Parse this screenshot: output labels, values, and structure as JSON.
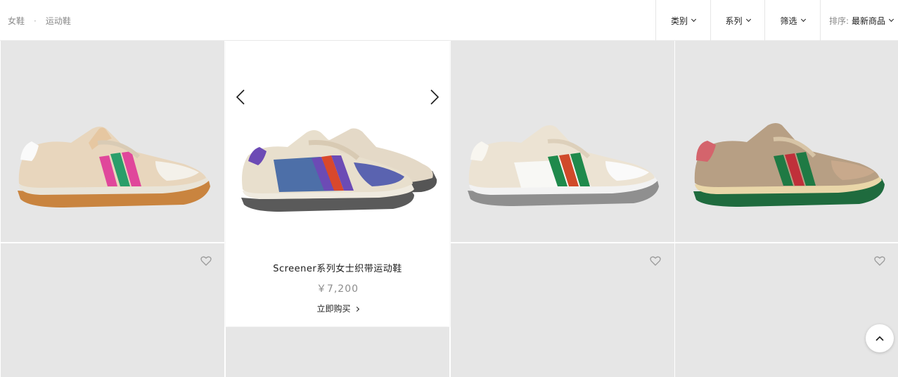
{
  "breadcrumb": {
    "items": [
      "女鞋",
      "运动鞋"
    ],
    "separator": "·"
  },
  "filters": {
    "category": "类别",
    "series": "系列",
    "filter": "筛选",
    "sort_label": "排序:",
    "sort_value": "最新商品"
  },
  "featured": {
    "title": "Screener系列女士织带运动鞋",
    "price": "￥7,200",
    "buy_label": "立即购买"
  },
  "products": [
    {
      "stripe": "pink-green",
      "colors": [
        "#2a9e6a",
        "#e0479b"
      ]
    },
    {
      "stripe": "blue-purple",
      "colors": [
        "#6c4bb5",
        "#d9482c"
      ]
    },
    {
      "stripe": "green-red",
      "colors": [
        "#1f8a4c",
        "#d04a2a"
      ]
    },
    {
      "stripe": "green-red-gg",
      "colors": [
        "#1f7a44",
        "#c0303a"
      ]
    }
  ],
  "colors": {
    "tile": "#e6e6e6",
    "text": "#1b1b1b",
    "muted": "#8a8a8a"
  }
}
